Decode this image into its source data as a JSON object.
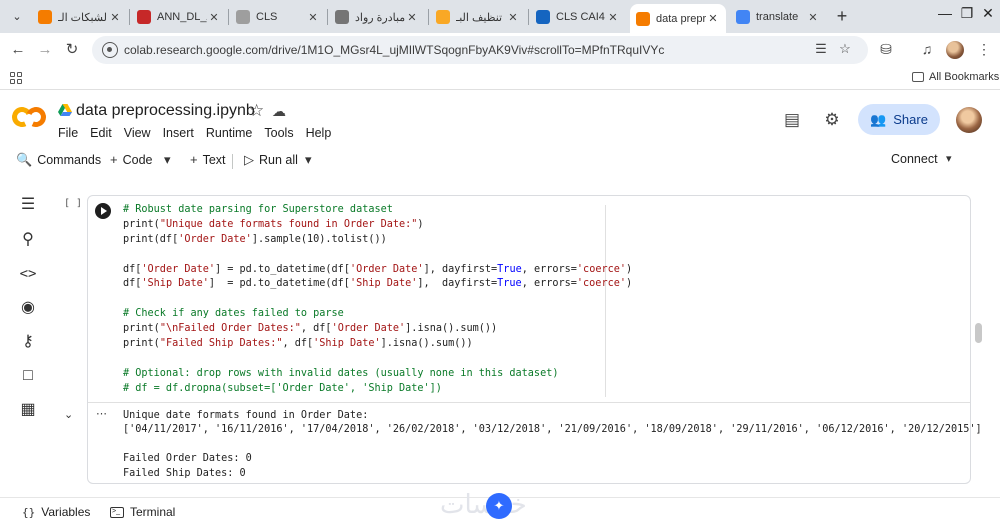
{
  "browser": {
    "tabs": [
      {
        "title": "الشبكات الـ",
        "favicon": "colab-icon",
        "color": "#f57c00"
      },
      {
        "title": "ANN_DL_A",
        "favicon": "pdf-icon",
        "color": "#c62828"
      },
      {
        "title": "CLS",
        "favicon": "doc-icon",
        "color": "#9e9e9e"
      },
      {
        "title": "مبادرة رواد",
        "favicon": "flag-icon",
        "color": "#757575"
      },
      {
        "title": "تنظيف البـ",
        "favicon": "b-icon",
        "color": "#f9a825"
      },
      {
        "title": "CLS CAI4",
        "favicon": "zoom-icon",
        "color": "#1565c0"
      },
      {
        "title": "data prepr",
        "favicon": "colab-icon",
        "color": "#f57c00"
      },
      {
        "title": "translate",
        "favicon": "google-icon",
        "color": "#4285f4"
      }
    ],
    "active_tab_index": 6,
    "url": "colab.research.google.com/drive/1M1O_MGsr4L_ujMIlWTSqognFbyAK9Viv#scrollTo=MPfnTRquIVYc",
    "all_bookmarks": "All Bookmarks"
  },
  "colab": {
    "title": "data preprocessing.ipynb",
    "menu": [
      "File",
      "Edit",
      "View",
      "Insert",
      "Runtime",
      "Tools",
      "Help"
    ],
    "share_label": "Share",
    "toolbar": {
      "commands": "Commands",
      "code": "Code",
      "text": "Text",
      "run_all": "Run all",
      "connect": "Connect"
    },
    "cell": {
      "exec_count": "[ ]",
      "code_lines": [
        [
          {
            "t": "# Robust date parsing for Superstore dataset",
            "c": "cm"
          }
        ],
        [
          {
            "t": "print(",
            "c": ""
          },
          {
            "t": "\"Unique date formats found in Order Date:\"",
            "c": "st"
          },
          {
            "t": ")",
            "c": ""
          }
        ],
        [
          {
            "t": "print(df[",
            "c": ""
          },
          {
            "t": "'Order Date'",
            "c": "st"
          },
          {
            "t": "].sample(10).tolist())",
            "c": ""
          }
        ],
        [
          {
            "t": "",
            "c": ""
          }
        ],
        [
          {
            "t": "df[",
            "c": ""
          },
          {
            "t": "'Order Date'",
            "c": "st"
          },
          {
            "t": "] = pd.to_datetime(df[",
            "c": ""
          },
          {
            "t": "'Order Date'",
            "c": "st"
          },
          {
            "t": "], dayfirst=",
            "c": ""
          },
          {
            "t": "True",
            "c": "kw"
          },
          {
            "t": ", errors=",
            "c": ""
          },
          {
            "t": "'coerce'",
            "c": "st"
          },
          {
            "t": ")",
            "c": ""
          }
        ],
        [
          {
            "t": "df[",
            "c": ""
          },
          {
            "t": "'Ship Date'",
            "c": "st"
          },
          {
            "t": "]  = pd.to_datetime(df[",
            "c": ""
          },
          {
            "t": "'Ship Date'",
            "c": "st"
          },
          {
            "t": "],  dayfirst=",
            "c": ""
          },
          {
            "t": "True",
            "c": "kw"
          },
          {
            "t": ", errors=",
            "c": ""
          },
          {
            "t": "'coerce'",
            "c": "st"
          },
          {
            "t": ")",
            "c": ""
          }
        ],
        [
          {
            "t": "",
            "c": ""
          }
        ],
        [
          {
            "t": "# Check if any dates failed to parse",
            "c": "cm"
          }
        ],
        [
          {
            "t": "print(",
            "c": ""
          },
          {
            "t": "\"\\nFailed Order Dates:\"",
            "c": "st"
          },
          {
            "t": ", df[",
            "c": ""
          },
          {
            "t": "'Order Date'",
            "c": "st"
          },
          {
            "t": "].isna().sum())",
            "c": ""
          }
        ],
        [
          {
            "t": "print(",
            "c": ""
          },
          {
            "t": "\"Failed Ship Dates:\"",
            "c": "st"
          },
          {
            "t": ", df[",
            "c": ""
          },
          {
            "t": "'Ship Date'",
            "c": "st"
          },
          {
            "t": "].isna().sum())",
            "c": ""
          }
        ],
        [
          {
            "t": "",
            "c": ""
          }
        ],
        [
          {
            "t": "# Optional: drop rows with invalid dates (usually none in this dataset)",
            "c": "cm"
          }
        ],
        [
          {
            "t": "# df = df.dropna(subset=['Order Date', 'Ship Date'])",
            "c": "cm"
          }
        ]
      ],
      "output_lines": [
        "Unique date formats found in Order Date:",
        "['04/11/2017', '16/11/2016', '17/04/2018', '26/02/2018', '03/12/2018', '21/09/2016', '18/09/2018', '29/11/2016', '06/12/2016', '20/12/2015']",
        "",
        "Failed Order Dates: 0",
        "Failed Ship Dates: 0"
      ]
    },
    "bottom": {
      "variables": "Variables",
      "terminal": "Terminal"
    }
  },
  "watermark": "خمسات"
}
